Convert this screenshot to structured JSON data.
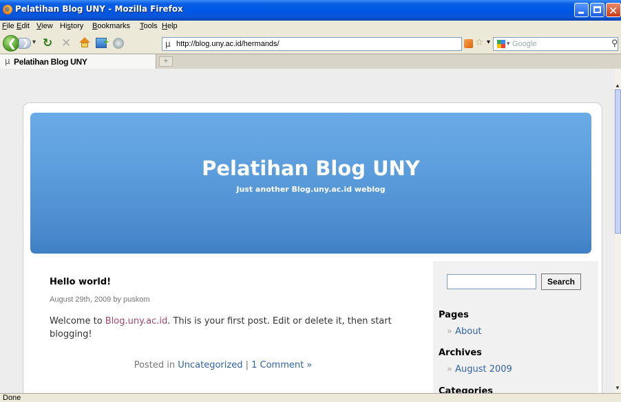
{
  "window": {
    "title": "Pelatihan Blog UNY - Mozilla Firefox"
  },
  "menu": {
    "items": [
      {
        "label": "File",
        "key": "F",
        "rest": "ile"
      },
      {
        "label": "Edit",
        "key": "E",
        "rest": "dit"
      },
      {
        "label": "View",
        "key": "V",
        "rest": "iew"
      },
      {
        "label": "History",
        "key": "s",
        "pre": "Hi",
        "rest": "tory"
      },
      {
        "label": "Bookmarks",
        "key": "B",
        "rest": "ookmarks"
      },
      {
        "label": "Tools",
        "key": "T",
        "rest": "ools"
      },
      {
        "label": "Help",
        "key": "H",
        "rest": "elp"
      }
    ]
  },
  "navbar": {
    "url": "http://blog.uny.ac.id/hermands/",
    "search_placeholder": "Google",
    "icons": [
      "back-icon",
      "forward-icon",
      "reload-icon",
      "stop-icon",
      "home-icon",
      "bookmark-icon",
      "rss-icon",
      "star-icon",
      "google-icon",
      "magnifier-icon"
    ]
  },
  "tab": {
    "label": "Pelatihan Blog UNY",
    "new_tab": "+"
  },
  "blog": {
    "title": "Pelatihan Blog UNY",
    "tagline": "Just another Blog.uny.ac.id weblog"
  },
  "post": {
    "title": "Hello world!",
    "date": "August 29th, 2009 by puskom",
    "body_prefix": "Welcome to ",
    "body_link": "Blog.uny.ac.id",
    "body_suffix": ". This is your first post. Edit or delete it, then start blogging!",
    "meta_prefix": "Posted in ",
    "category": "Uncategorized",
    "separator": " | ",
    "comments": "1 Comment »"
  },
  "sidebar": {
    "search_button": "Search",
    "pages_heading": "Pages",
    "pages": [
      "About"
    ],
    "archives_heading": "Archives",
    "archives": [
      "August 2009"
    ],
    "categories_heading": "Categories",
    "link_prefix": "» "
  },
  "status": {
    "text": "Done"
  },
  "colors": {
    "titlebar": "#0058e6",
    "header_blue": "#5c9edd",
    "link_blue": "#2f63a9",
    "link_pink": "#a4466e"
  }
}
